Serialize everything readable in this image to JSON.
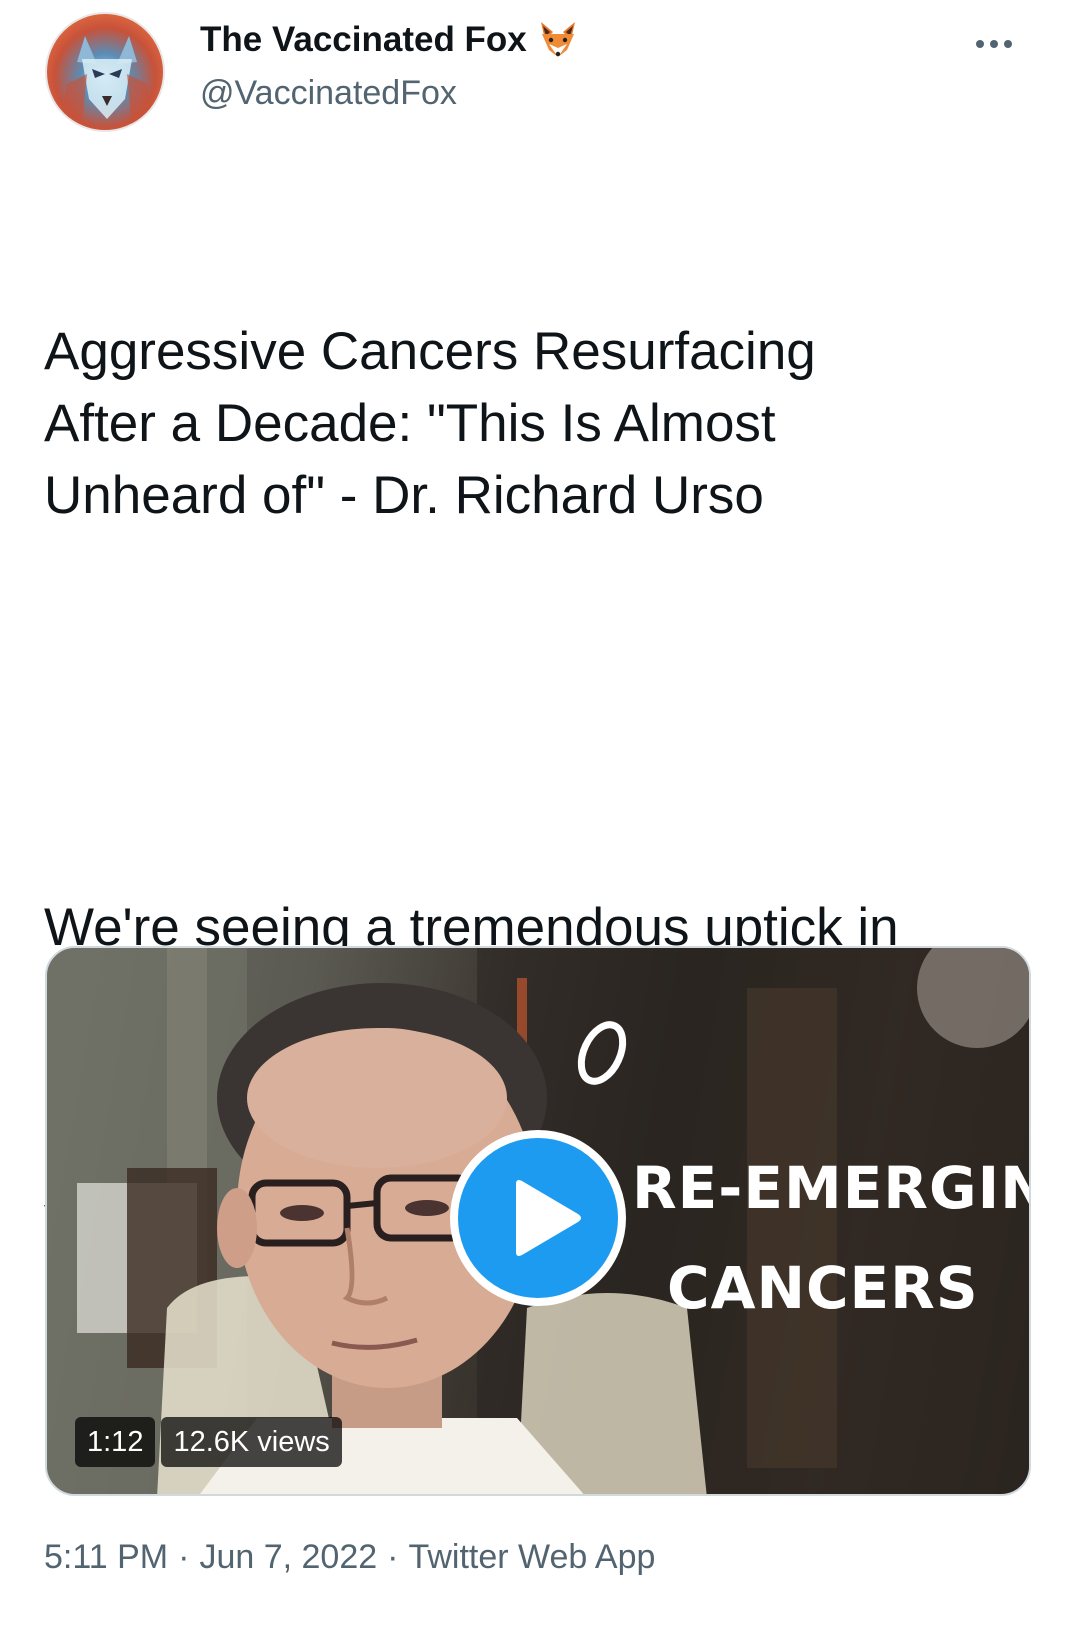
{
  "author": {
    "name": "The Vaccinated Fox",
    "handle": "@VaccinatedFox",
    "avatar_icon": "fox-portrait-avatar",
    "name_emoji_icon": "fox-face-icon"
  },
  "tweet": {
    "headline": "Aggressive Cancers Resurfacing After a Decade: \"This Is Almost Unheard of\" - Dr. Richard Urso",
    "body": "We're seeing a tremendous uptick in cancers. I'm having recurrences in people who were 10 years clear...which is almost unheard of to be clear [for] 10 years and then have it come back."
  },
  "media": {
    "overlay_line1": "RE-EMERGING",
    "overlay_line2": "CANCERS",
    "duration": "1:12",
    "views": "12.6K views",
    "play_icon": "play-icon",
    "accent_color": "#1d9bf0"
  },
  "meta": {
    "time": "5:11 PM",
    "date": "Jun 7, 2022",
    "separator": "·",
    "source": "Twitter Web App"
  }
}
